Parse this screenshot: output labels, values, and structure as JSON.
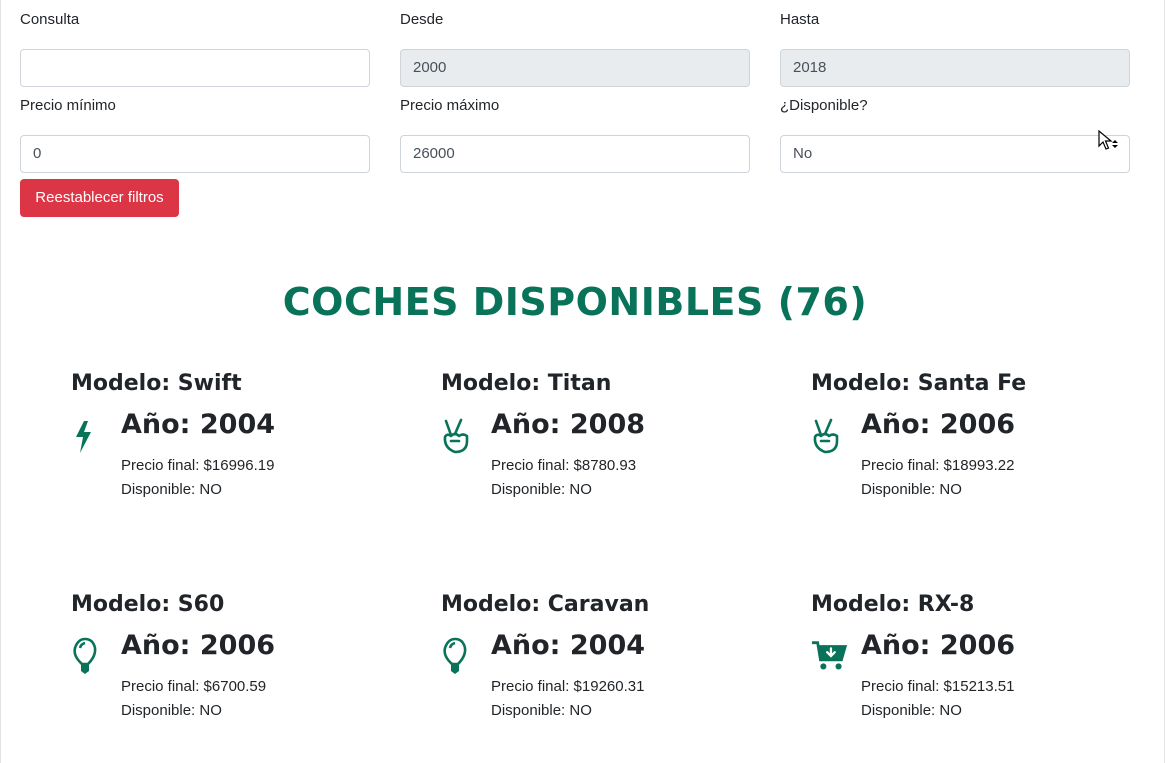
{
  "filters": {
    "consulta": {
      "label": "Consulta",
      "value": ""
    },
    "desde": {
      "label": "Desde",
      "value": "2000"
    },
    "hasta": {
      "label": "Hasta",
      "value": "2018"
    },
    "precio_min": {
      "label": "Precio mínimo",
      "value": "0"
    },
    "precio_max": {
      "label": "Precio máximo",
      "value": "26000"
    },
    "disponible": {
      "label": "¿Disponible?",
      "value": "No"
    },
    "reset_label": "Reestablecer filtros"
  },
  "heading": "COCHES DISPONIBLES (76)",
  "colors": {
    "accent": "#087358",
    "danger": "#dc3545",
    "readonly_bg": "#e9ecef"
  },
  "cars": [
    {
      "model": "Modelo: Swift",
      "year": "Año: 2004",
      "price": "Precio final: $16996.19",
      "available": "Disponible: NO",
      "icon": "bolt-icon"
    },
    {
      "model": "Modelo: Titan",
      "year": "Año: 2008",
      "price": "Precio final: $8780.93",
      "available": "Disponible: NO",
      "icon": "peace-hand-icon"
    },
    {
      "model": "Modelo: Santa Fe",
      "year": "Año: 2006",
      "price": "Precio final: $18993.22",
      "available": "Disponible: NO",
      "icon": "peace-hand-icon"
    },
    {
      "model": "Modelo: S60",
      "year": "Año: 2006",
      "price": "Precio final: $6700.59",
      "available": "Disponible: NO",
      "icon": "lightbulb-icon"
    },
    {
      "model": "Modelo: Caravan",
      "year": "Año: 2004",
      "price": "Precio final: $19260.31",
      "available": "Disponible: NO",
      "icon": "lightbulb-icon"
    },
    {
      "model": "Modelo: RX-8",
      "year": "Año: 2006",
      "price": "Precio final: $15213.51",
      "available": "Disponible: NO",
      "icon": "cart-arrow-down-icon"
    }
  ]
}
